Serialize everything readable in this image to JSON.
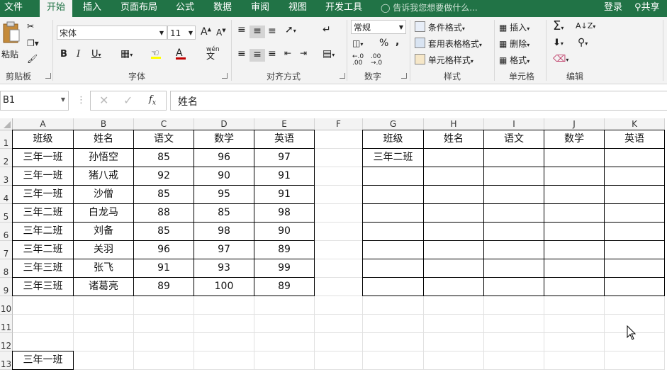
{
  "tabs": [
    "文件",
    "开始",
    "插入",
    "页面布局",
    "公式",
    "数据",
    "审阅",
    "视图",
    "开发工具"
  ],
  "tell_me": "告诉我您想要做什么...",
  "login": "登录",
  "share": "共享",
  "clipboard": {
    "paste": "粘贴",
    "label": "剪贴板"
  },
  "font": {
    "name": "宋体",
    "size": "11",
    "label": "字体",
    "wen": "wén"
  },
  "alignment": {
    "label": "对齐方式"
  },
  "number": {
    "format": "常规",
    "label": "数字"
  },
  "styles": {
    "conditional": "条件格式",
    "table": "套用表格格式",
    "cell": "单元格样式",
    "label": "样式"
  },
  "cells": {
    "insert": "插入",
    "delete": "删除",
    "format": "格式",
    "label": "单元格"
  },
  "editing": {
    "label": "编辑"
  },
  "formula_bar": {
    "name_box": "B1",
    "value": "姓名"
  },
  "columns": [
    "A",
    "B",
    "C",
    "D",
    "E",
    "F",
    "G",
    "H",
    "I",
    "J",
    "K"
  ],
  "rows": [
    "1",
    "2",
    "3",
    "4",
    "5",
    "6",
    "7",
    "8",
    "9",
    "10",
    "11",
    "12",
    "13"
  ],
  "table1": {
    "headers": [
      "班级",
      "姓名",
      "语文",
      "数学",
      "英语"
    ],
    "rows": [
      [
        "三年一班",
        "孙悟空",
        "85",
        "96",
        "97"
      ],
      [
        "三年一班",
        "猪八戒",
        "92",
        "90",
        "91"
      ],
      [
        "三年一班",
        "沙僧",
        "85",
        "95",
        "91"
      ],
      [
        "三年二班",
        "白龙马",
        "88",
        "85",
        "98"
      ],
      [
        "三年二班",
        "刘备",
        "85",
        "98",
        "90"
      ],
      [
        "三年二班",
        "关羽",
        "96",
        "97",
        "89"
      ],
      [
        "三年三班",
        "张飞",
        "91",
        "93",
        "99"
      ],
      [
        "三年三班",
        "诸葛亮",
        "89",
        "100",
        "89"
      ]
    ]
  },
  "table2": {
    "headers": [
      "班级",
      "姓名",
      "语文",
      "数学",
      "英语"
    ],
    "g2": "三年二班"
  },
  "a13": "三年一班"
}
